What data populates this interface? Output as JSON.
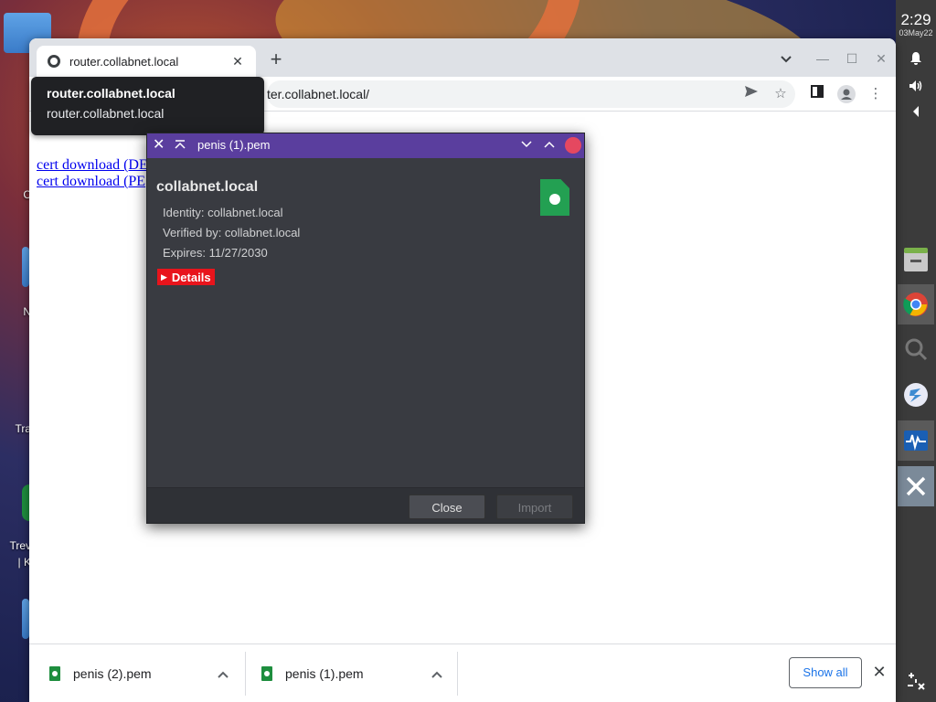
{
  "shelf": {
    "time": "2:29",
    "date": "03May22"
  },
  "desktop": {
    "labels": [
      "C",
      "N",
      "Tra",
      "Trev",
      "| K"
    ]
  },
  "browser": {
    "tab_title": "router.collabnet.local",
    "url": "ter.collabnet.local/",
    "tooltip": {
      "title": "router.collabnet.local",
      "subtitle": "router.collabnet.local"
    },
    "links": [
      "cert download (DE",
      "cert download (PE"
    ]
  },
  "dialog": {
    "title": "penis (1).pem",
    "cert_name": "collabnet.local",
    "identity": "Identity: collabnet.local",
    "verified_by": "Verified by: collabnet.local",
    "expires": "Expires: 11/27/2030",
    "details_label": "Details",
    "close_label": "Close",
    "import_label": "Import"
  },
  "downloads": {
    "items": [
      {
        "name": "penis (2).pem"
      },
      {
        "name": "penis (1).pem"
      }
    ],
    "show_all": "Show all"
  }
}
